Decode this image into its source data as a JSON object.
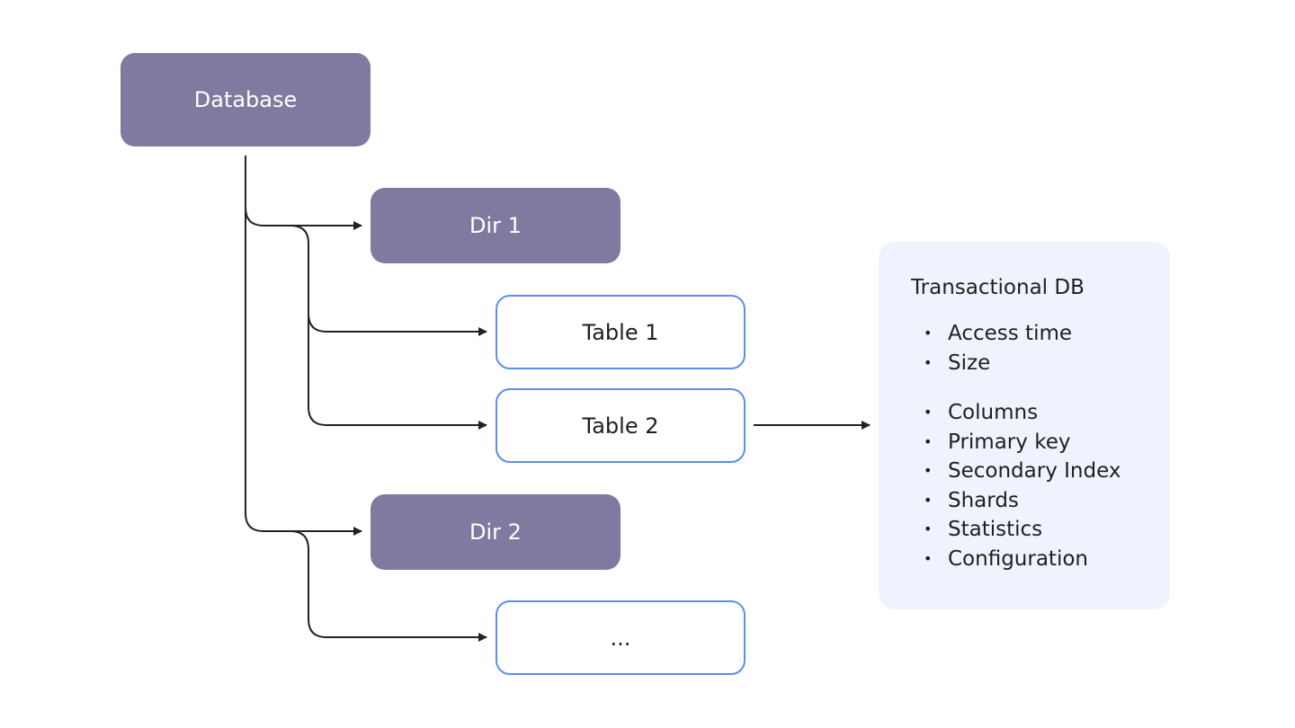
{
  "nodes": {
    "database": "Database",
    "dir1": "Dir 1",
    "table1": "Table 1",
    "table2": "Table 2",
    "dir2": "Dir 2",
    "more": "..."
  },
  "info_panel": {
    "title": "Transactional DB",
    "group1": [
      "Access time",
      "Size"
    ],
    "group2": [
      "Columns",
      "Primary key",
      "Secondary Index",
      "Shards",
      "Statistics",
      "Configuration"
    ]
  },
  "colors": {
    "dir_fill": "#7f7a9f",
    "table_border": "#5a8ef0",
    "panel_fill": "#eef3fd",
    "edge": "#222222"
  },
  "edges": [
    {
      "from": "database",
      "to": "dir1"
    },
    {
      "from": "database",
      "to": "dir2"
    },
    {
      "from": "dir1",
      "to": "table1"
    },
    {
      "from": "dir1",
      "to": "table2"
    },
    {
      "from": "dir2",
      "to": "more"
    },
    {
      "from": "table2",
      "to": "info_panel"
    }
  ]
}
